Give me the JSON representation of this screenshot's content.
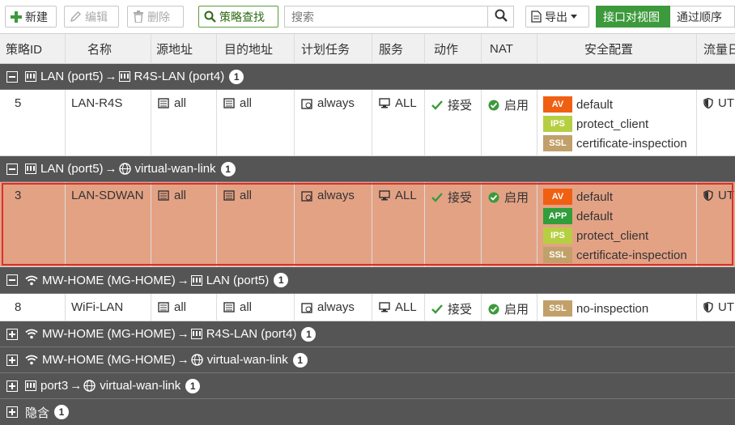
{
  "toolbar": {
    "new_label": "新建",
    "edit_label": "编辑",
    "delete_label": "删除",
    "policy_lookup_label": "策略查找",
    "search_placeholder": "搜索",
    "export_label": "导出",
    "view_interface_pair": "接口对视图",
    "view_by_sequence": "通过顺序"
  },
  "columns": [
    "策略ID",
    "名称",
    "源地址",
    "目的地址",
    "计划任务",
    "服务",
    "动作",
    "NAT",
    "安全配置",
    "流量日"
  ],
  "groups": [
    {
      "src_if": "LAN (port5)",
      "dst_if": "R4S-LAN (port4)",
      "count": "1",
      "expanded": true,
      "rows": [
        {
          "id": "5",
          "name": "LAN-R4S",
          "src": "all",
          "dst": "all",
          "schedule": "always",
          "service": "ALL",
          "action": "接受",
          "nat": "启用",
          "security": [
            {
              "badge": "AV",
              "value": "default"
            },
            {
              "badge": "IPS",
              "value": "protect_client"
            },
            {
              "badge": "SSL",
              "value": "certificate-inspection"
            }
          ],
          "log": "UT"
        }
      ]
    },
    {
      "src_if": "LAN (port5)",
      "dst_if": "virtual-wan-link",
      "count": "1",
      "expanded": true,
      "rows": [
        {
          "id": "3",
          "name": "LAN-SDWAN",
          "src": "all",
          "dst": "all",
          "schedule": "always",
          "service": "ALL",
          "action": "接受",
          "nat": "启用",
          "security": [
            {
              "badge": "AV",
              "value": "default"
            },
            {
              "badge": "APP",
              "value": "default"
            },
            {
              "badge": "IPS",
              "value": "protect_client"
            },
            {
              "badge": "SSL",
              "value": "certificate-inspection"
            }
          ],
          "log": "UT",
          "selected": true
        }
      ]
    },
    {
      "src_if": "MW-HOME (MG-HOME)",
      "dst_if": "LAN (port5)",
      "count": "1",
      "expanded": true,
      "rows": [
        {
          "id": "8",
          "name": "WiFi-LAN",
          "src": "all",
          "dst": "all",
          "schedule": "always",
          "service": "ALL",
          "action": "接受",
          "nat": "启用",
          "security": [
            {
              "badge": "SSL",
              "value": "no-inspection"
            }
          ],
          "log": "UT"
        }
      ]
    },
    {
      "src_if": "MW-HOME (MG-HOME)",
      "dst_if": "R4S-LAN (port4)",
      "count": "1",
      "expanded": false,
      "rows": []
    },
    {
      "src_if": "MW-HOME (MG-HOME)",
      "dst_if": "virtual-wan-link",
      "count": "1",
      "expanded": false,
      "rows": []
    },
    {
      "src_if": "port3",
      "dst_if": "virtual-wan-link",
      "count": "1",
      "expanded": false,
      "rows": []
    },
    {
      "src_if": "隐含",
      "dst_if": "",
      "count": "1",
      "expanded": false,
      "rows": []
    }
  ],
  "colors": {
    "accent_green": "#3c9a3c",
    "group_bg": "#555555",
    "selected_row_bg": "#e4a285",
    "selected_outline": "#d9312f",
    "badge_av": "#f06013",
    "badge_app": "#2f9e3b",
    "badge_ips": "#b6cf42",
    "badge_ssl": "#c1a06a"
  }
}
